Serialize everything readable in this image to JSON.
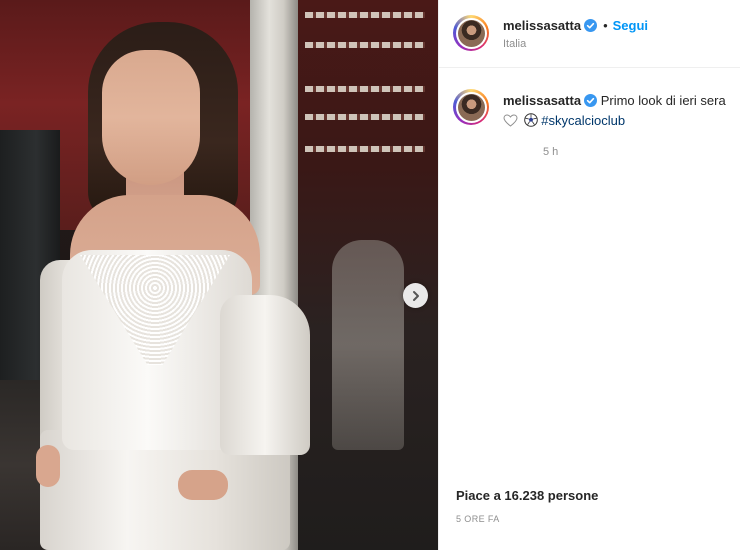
{
  "post": {
    "username": "melissasatta",
    "follow_label": "Segui",
    "separator": "•",
    "location": "Italia",
    "caption": {
      "username": "melissasatta",
      "text": "Primo look di ieri sera",
      "hashtag": "#skycalcioclub",
      "emojis": [
        "white-heart",
        "soccer-ball"
      ],
      "time_ago": "5 h"
    },
    "likes_text": "Piace a 16.238 persone",
    "date_text": "5 ORE FA",
    "colors": {
      "link_blue": "#0095f6",
      "hashtag_blue": "#00376b",
      "verified_blue": "#3897f0",
      "muted": "#8e8e8e"
    }
  }
}
